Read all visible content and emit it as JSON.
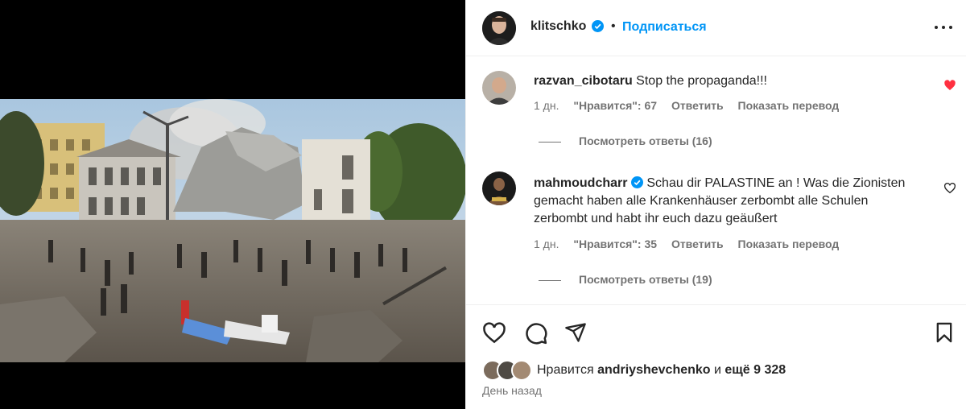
{
  "post": {
    "image_alt_icon": "destroyed-hospital-photo"
  },
  "header": {
    "username": "klitschko",
    "dot": "•",
    "follow_label": "Подписаться"
  },
  "comments": [
    {
      "username": "razvan_cibotaru",
      "verified": false,
      "text": "Stop the propaganda!!!",
      "time": "1 дн.",
      "likes": "\"Нравится\": 67",
      "reply_label": "Ответить",
      "translate_label": "Показать перевод",
      "view_replies": "Посмотреть ответы (16)",
      "liked": true
    },
    {
      "username": "mahmoudcharr",
      "verified": true,
      "text": "Schau dir PALASTINE an ! Was die Zionisten gemacht haben alle Krankenhäuser zerbombt alle Schulen zerbombt und habt ihr euch dazu geäußert",
      "time": "1 дн.",
      "likes": "\"Нравится\": 35",
      "reply_label": "Ответить",
      "translate_label": "Показать перевод",
      "view_replies": "Посмотреть ответы (19)",
      "liked": false
    }
  ],
  "likes_bar": {
    "prefix": "Нравится",
    "user": "andriyshevchenko",
    "middle": "и",
    "others": "ещё 9 328"
  },
  "date": "День назад",
  "colors": {
    "accent": "#0095f6",
    "like_red": "#ff3040",
    "muted": "#737373"
  }
}
